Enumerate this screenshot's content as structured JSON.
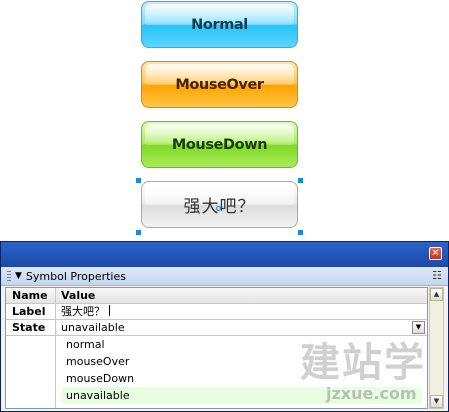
{
  "buttons": {
    "normal": "Normal",
    "mouse_over": "MouseOver",
    "mouse_down": "MouseDown",
    "selected_instance": "强大吧？"
  },
  "panel": {
    "close_glyph": "✕",
    "title": "Symbol Properties",
    "columns": {
      "name": "Name",
      "value": "Value"
    },
    "rows": {
      "label": {
        "name": "Label",
        "value": "强大吧？"
      },
      "state": {
        "name": "State",
        "value": "unavailable"
      }
    },
    "state_options": [
      "normal",
      "mouseOver",
      "mouseDown",
      "unavailable"
    ]
  },
  "watermark": {
    "text": "建站学",
    "url": "jzxue.com"
  },
  "colors": {
    "normal": "#28c4f7",
    "mouse_over": "#ffa300",
    "mouse_down": "#7fd924",
    "titlebar": "#1d4aa8",
    "selected_option_bg": "#e6ffe0"
  }
}
